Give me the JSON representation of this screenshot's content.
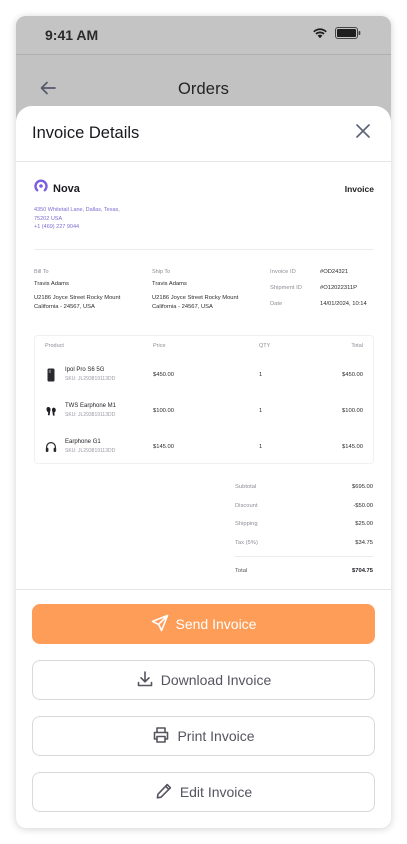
{
  "status_bar": {
    "time": "9:41 AM"
  },
  "nav": {
    "title": "Orders"
  },
  "sheet": {
    "title": "Invoice Details"
  },
  "invoice": {
    "brand_name": "Nova",
    "doc_label": "Invoice",
    "address_line1": "4350 Whitetail Lane, Dallas, Texas,",
    "address_line2": "75202 USA",
    "phone": "+1 (469) 227 9044",
    "bill_to": {
      "label": "Bill To",
      "name": "Travis Adams",
      "address_line1": "U2186 Joyce Street Rocky Mount",
      "address_line2": "California - 24567, USA"
    },
    "ship_to": {
      "label": "Ship To",
      "name": "Travis Adams",
      "address_line1": "U2186 Joyce Street Rocky Mount",
      "address_line2": "California - 24567, USA"
    },
    "details": {
      "invoice_id_label": "Invoice ID",
      "invoice_id": "#OD24321",
      "shipment_id_label": "Shipment ID",
      "shipment_id": "#O12022311P",
      "date_label": "Date",
      "date": "14/01/2024, 10:14"
    },
    "table": {
      "headers": {
        "product": "Product",
        "price": "Price",
        "qty": "QTY",
        "total": "Total"
      },
      "rows": [
        {
          "icon": "phone-icon",
          "name": "Ipol Pro S6 5G",
          "sku": "SKU: JL293819113DD",
          "price": "$450.00",
          "qty": "1",
          "total": "$450.00"
        },
        {
          "icon": "earbuds-icon",
          "name": "TWS Earphone M1",
          "sku": "SKU: JL293819113DD",
          "price": "$100.00",
          "qty": "1",
          "total": "$100.00"
        },
        {
          "icon": "headphones-icon",
          "name": "Earphone G1",
          "sku": "SKU: JL293819113DD",
          "price": "$145.00",
          "qty": "1",
          "total": "$145.00"
        }
      ]
    },
    "summary": {
      "subtotal_label": "Subtotal",
      "subtotal": "$695.00",
      "discount_label": "Discount",
      "discount": "-$50.00",
      "shipping_label": "Shipping",
      "shipping": "$25.00",
      "tax_label": "Tax (5%)",
      "tax": "$34.75",
      "total_label": "Total",
      "total": "$704.75"
    }
  },
  "actions": {
    "send": "Send Invoice",
    "download": "Download Invoice",
    "print": "Print Invoice",
    "edit": "Edit Invoice"
  },
  "colors": {
    "primary": "#fd9d57",
    "brand": "#7b5fe0",
    "overlay": "#c2c2c2"
  }
}
